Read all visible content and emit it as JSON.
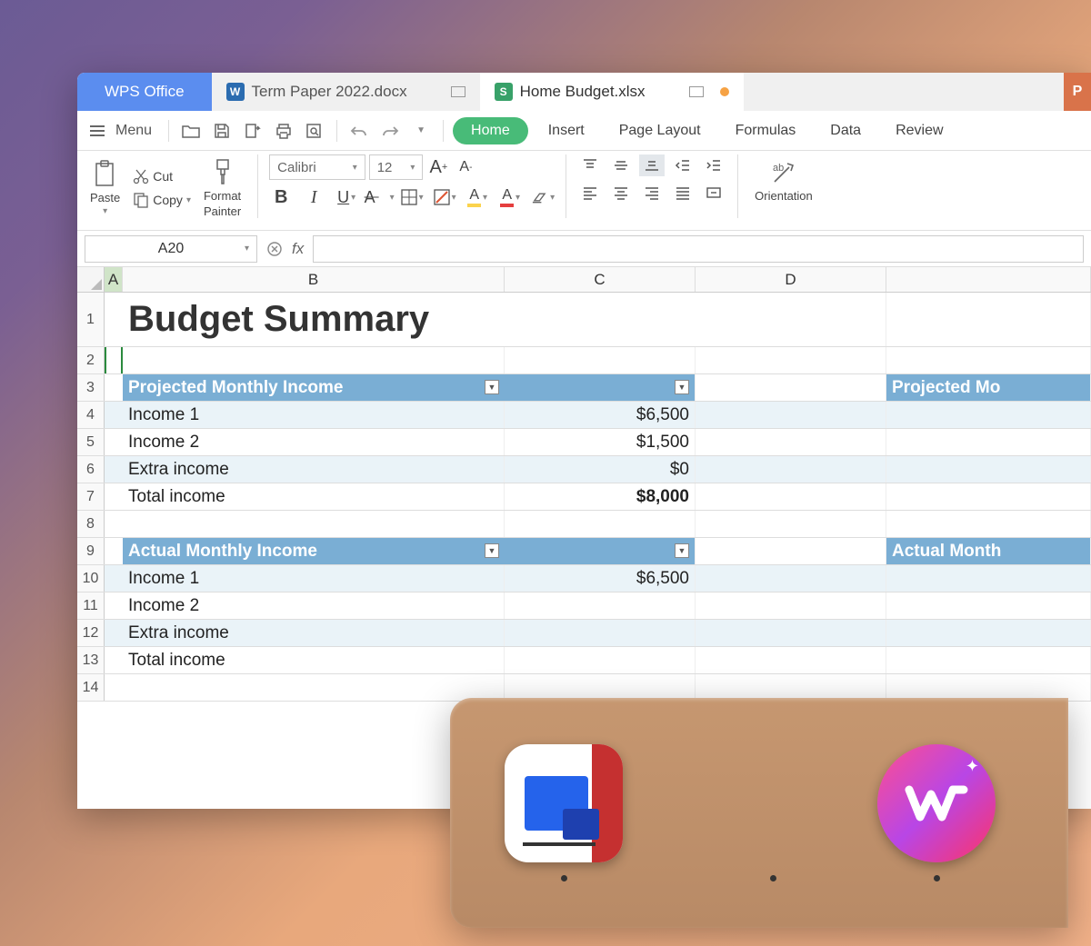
{
  "tabs": {
    "main": "WPS Office",
    "doc1": "Term Paper 2022.docx",
    "doc2": "Home Budget.xlsx"
  },
  "menu": {
    "label": "Menu"
  },
  "ribbon_tabs": [
    "Home",
    "Insert",
    "Page Layout",
    "Formulas",
    "Data",
    "Review"
  ],
  "clipboard": {
    "paste": "Paste",
    "cut": "Cut",
    "copy": "Copy",
    "format_painter_l1": "Format",
    "format_painter_l2": "Painter"
  },
  "font": {
    "name": "Calibri",
    "size": "12"
  },
  "orientation": "Orientation",
  "namebox": "A20",
  "fx": "fx",
  "columns": [
    "A",
    "B",
    "C",
    "D"
  ],
  "row_numbers": [
    "1",
    "2",
    "3",
    "4",
    "5",
    "6",
    "7",
    "8",
    "9",
    "10",
    "11",
    "12",
    "13",
    "14"
  ],
  "title": "Budget Summary",
  "section1_header": "Projected Monthly Income",
  "section2_header": "Actual Monthly Income",
  "side_header1": "Projected Mo",
  "side_header2": "Actual Month",
  "rows": {
    "income1": {
      "label": "Income 1",
      "val": "$6,500"
    },
    "income2": {
      "label": "Income 2",
      "val": "$1,500"
    },
    "extra": {
      "label": "Extra income",
      "val": "$0"
    },
    "total": {
      "label": "Total income",
      "val": "$8,000"
    },
    "a_income1": {
      "label": "Income 1",
      "val": "$6,500"
    },
    "a_income2": {
      "label": "Income 2"
    },
    "a_extra": {
      "label": "Extra income"
    },
    "a_total": {
      "label": "Total income"
    }
  }
}
